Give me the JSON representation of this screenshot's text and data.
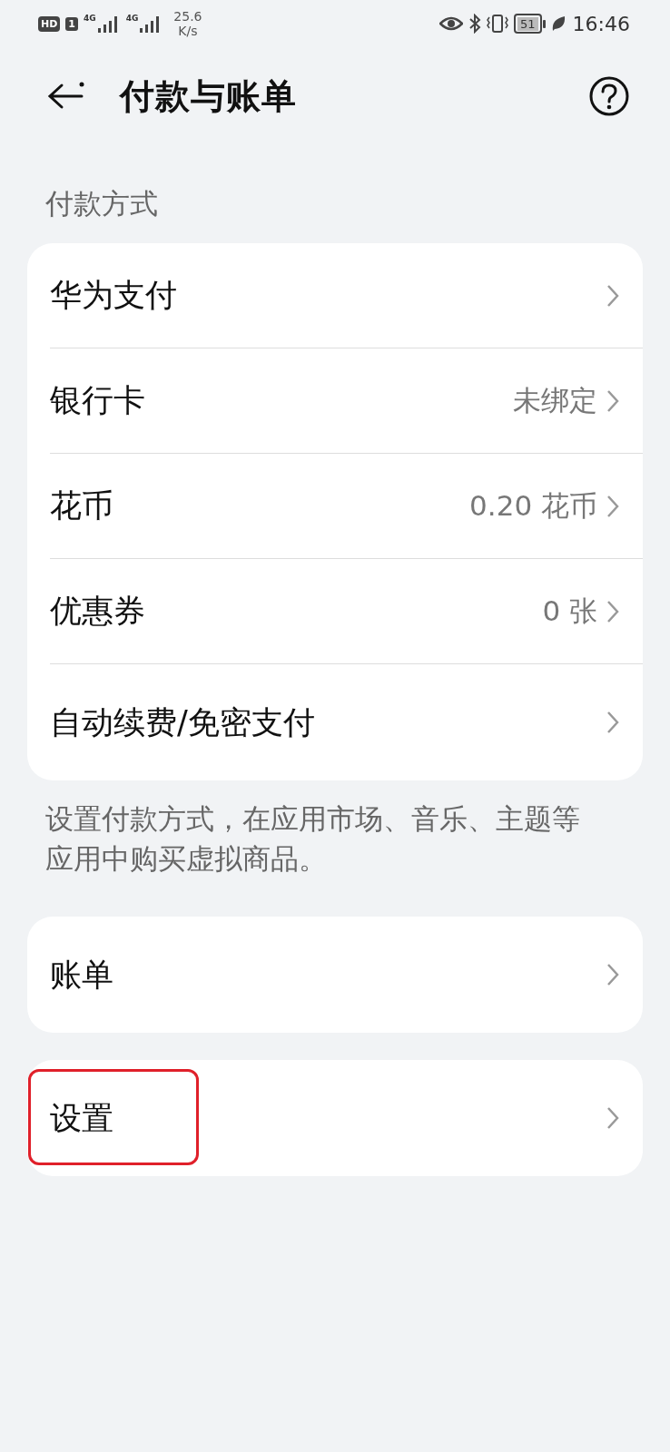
{
  "status_bar": {
    "hd": "HD",
    "sim": "1",
    "network_1": "4G",
    "network_2": "4G",
    "speed": "25.6",
    "speed_unit": "K/s",
    "battery": "51",
    "time": "16:46"
  },
  "header": {
    "title": "付款与账单"
  },
  "sections": [
    {
      "title": "付款方式",
      "items": [
        {
          "label": "华为支付",
          "highlighted": false
        },
        {
          "label": "银行卡",
          "value": "未绑定",
          "highlighted": false
        },
        {
          "label": "花币",
          "value": "0.20 花币",
          "highlighted": false
        },
        {
          "label": "优惠券",
          "value": "0 张",
          "highlighted": false
        },
        {
          "label": "自动续费/免密支付",
          "highlighted": false
        }
      ],
      "note": "设置付款方式，在应用市场、音乐、主题等应用中购买虚拟商品。"
    },
    {
      "items": [
        {
          "label": "账单",
          "highlighted": false
        }
      ]
    },
    {
      "items": [
        {
          "label": "设置",
          "highlighted": true
        }
      ]
    }
  ]
}
